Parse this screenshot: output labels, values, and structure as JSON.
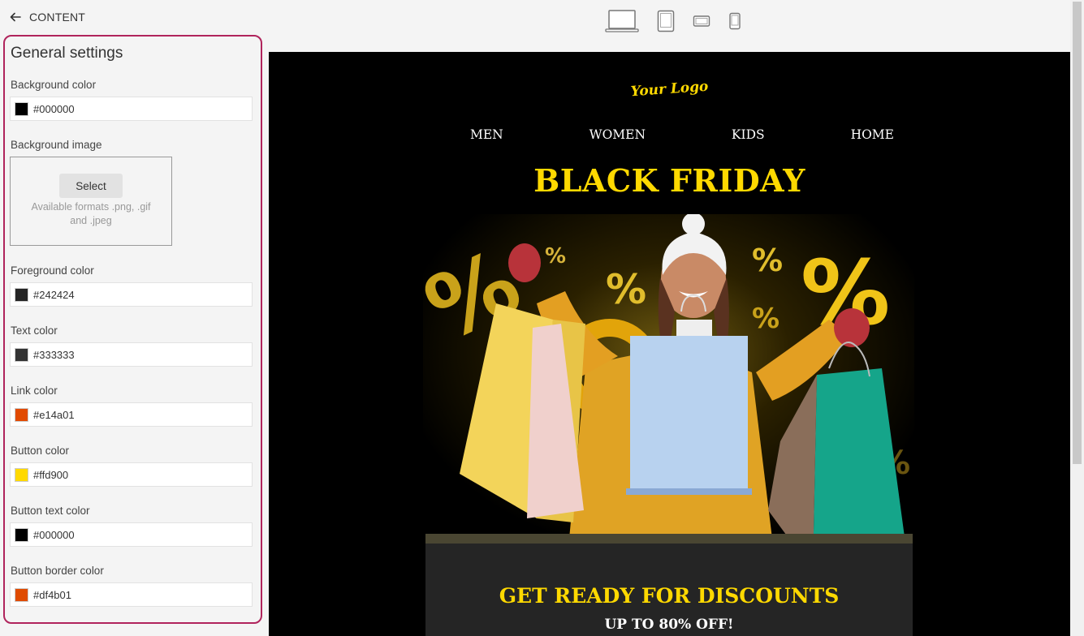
{
  "topbar": {
    "back_label": "CONTENT",
    "back_icon": "arrow-left-icon"
  },
  "panel": {
    "title": "General settings",
    "fields": [
      {
        "label": "Background color",
        "value": "#000000",
        "swatch": "#000000"
      },
      {
        "label": "Background image",
        "button": "Select",
        "hint": "Available formats .png, .gif and .jpeg"
      },
      {
        "label": "Foreground color",
        "value": "#242424",
        "swatch": "#242424"
      },
      {
        "label": "Text color",
        "value": "#333333",
        "swatch": "#333333"
      },
      {
        "label": "Link color",
        "value": "#e14a01",
        "swatch": "#e14a01"
      },
      {
        "label": "Button color",
        "value": "#ffd900",
        "swatch": "#ffd900"
      },
      {
        "label": "Button text color",
        "value": "#000000",
        "swatch": "#000000"
      },
      {
        "label": "Button border color",
        "value": "#df4b01",
        "swatch": "#df4b01"
      }
    ]
  },
  "devices": [
    "desktop-icon",
    "tablet-icon",
    "tablet-landscape-icon",
    "mobile-icon"
  ],
  "preview": {
    "logo": "Your Logo",
    "nav": [
      "MEN",
      "WOMEN",
      "KIDS",
      "HOME"
    ],
    "headline": "BLACK FRIDAY",
    "subheadline": "GET READY FOR DISCOUNTS",
    "offer": "UP TO 80% OFF!",
    "hero_glyphs": [
      "%",
      "%",
      "%",
      "%",
      "%",
      "%",
      "%"
    ]
  }
}
